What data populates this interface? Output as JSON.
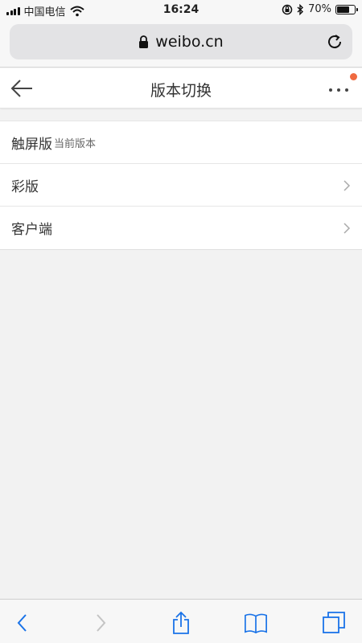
{
  "status_bar": {
    "carrier": "中国电信",
    "time": "16:24",
    "battery": "70%",
    "battery_level": 0.7,
    "icons": [
      "signal-icon",
      "wifi-icon",
      "orientation-lock-icon",
      "bluetooth-icon",
      "battery-icon"
    ]
  },
  "browser": {
    "url": "weibo.cn",
    "icons": [
      "lock-icon",
      "reload-icon"
    ]
  },
  "header": {
    "title": "版本切换",
    "icons": [
      "back-arrow-icon",
      "more-icon"
    ],
    "notify_color": "#ef6a40"
  },
  "list": {
    "items": [
      {
        "label": "触屏版",
        "tag": "当前版本"
      },
      {
        "label": "彩版"
      },
      {
        "label": "客户端"
      }
    ]
  },
  "toolbar": {
    "icons": [
      "back-icon",
      "forward-icon",
      "share-icon",
      "bookmarks-icon",
      "tabs-icon"
    ],
    "accent": "#1a73e8"
  }
}
